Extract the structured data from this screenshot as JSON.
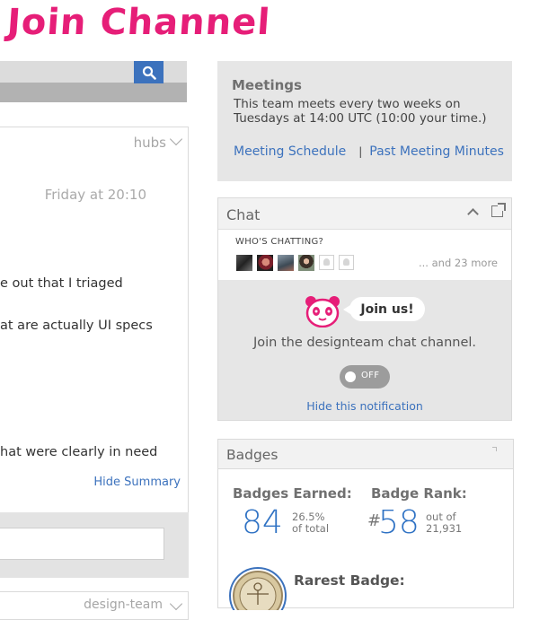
{
  "header": {
    "title": "Join Channel"
  },
  "feed": {
    "filter_label": "hubs",
    "timestamp": "Friday at 20:10",
    "lines": [
      "e out that I triaged",
      "at are actually UI specs",
      "hat were clearly in need"
    ],
    "hide_summary": "Hide Summary",
    "next_card_label": "design-team"
  },
  "meetings": {
    "heading": "Meetings",
    "description": "This team meets every two weeks on Tuesdays at 14:00 UTC (10:00 your time.)",
    "schedule_link": "Meeting Schedule",
    "separator": "|",
    "minutes_link": "Past Meeting Minutes"
  },
  "chat": {
    "title": "Chat",
    "whos_chatting": "WHO'S CHATTING?",
    "more": "... and 23 more",
    "join_bubble": "Join us!",
    "join_text": "Join the designteam chat channel.",
    "toggle_state": "OFF",
    "hide_notification": "Hide this notification"
  },
  "badges": {
    "title": "Badges",
    "earned_label": "Badges Earned:",
    "earned_count": "84",
    "earned_pct": "26.5%",
    "earned_pct_suffix": "of total",
    "rank_label": "Badge Rank:",
    "rank_hash": "#",
    "rank_value": "58",
    "rank_out_of": "out of",
    "rank_total": "21,931",
    "rarest_label": "Rarest Badge:"
  },
  "colors": {
    "accent": "#3c72bd",
    "title_pink": "#e61e78",
    "panel_gray": "#e6e6e6"
  }
}
